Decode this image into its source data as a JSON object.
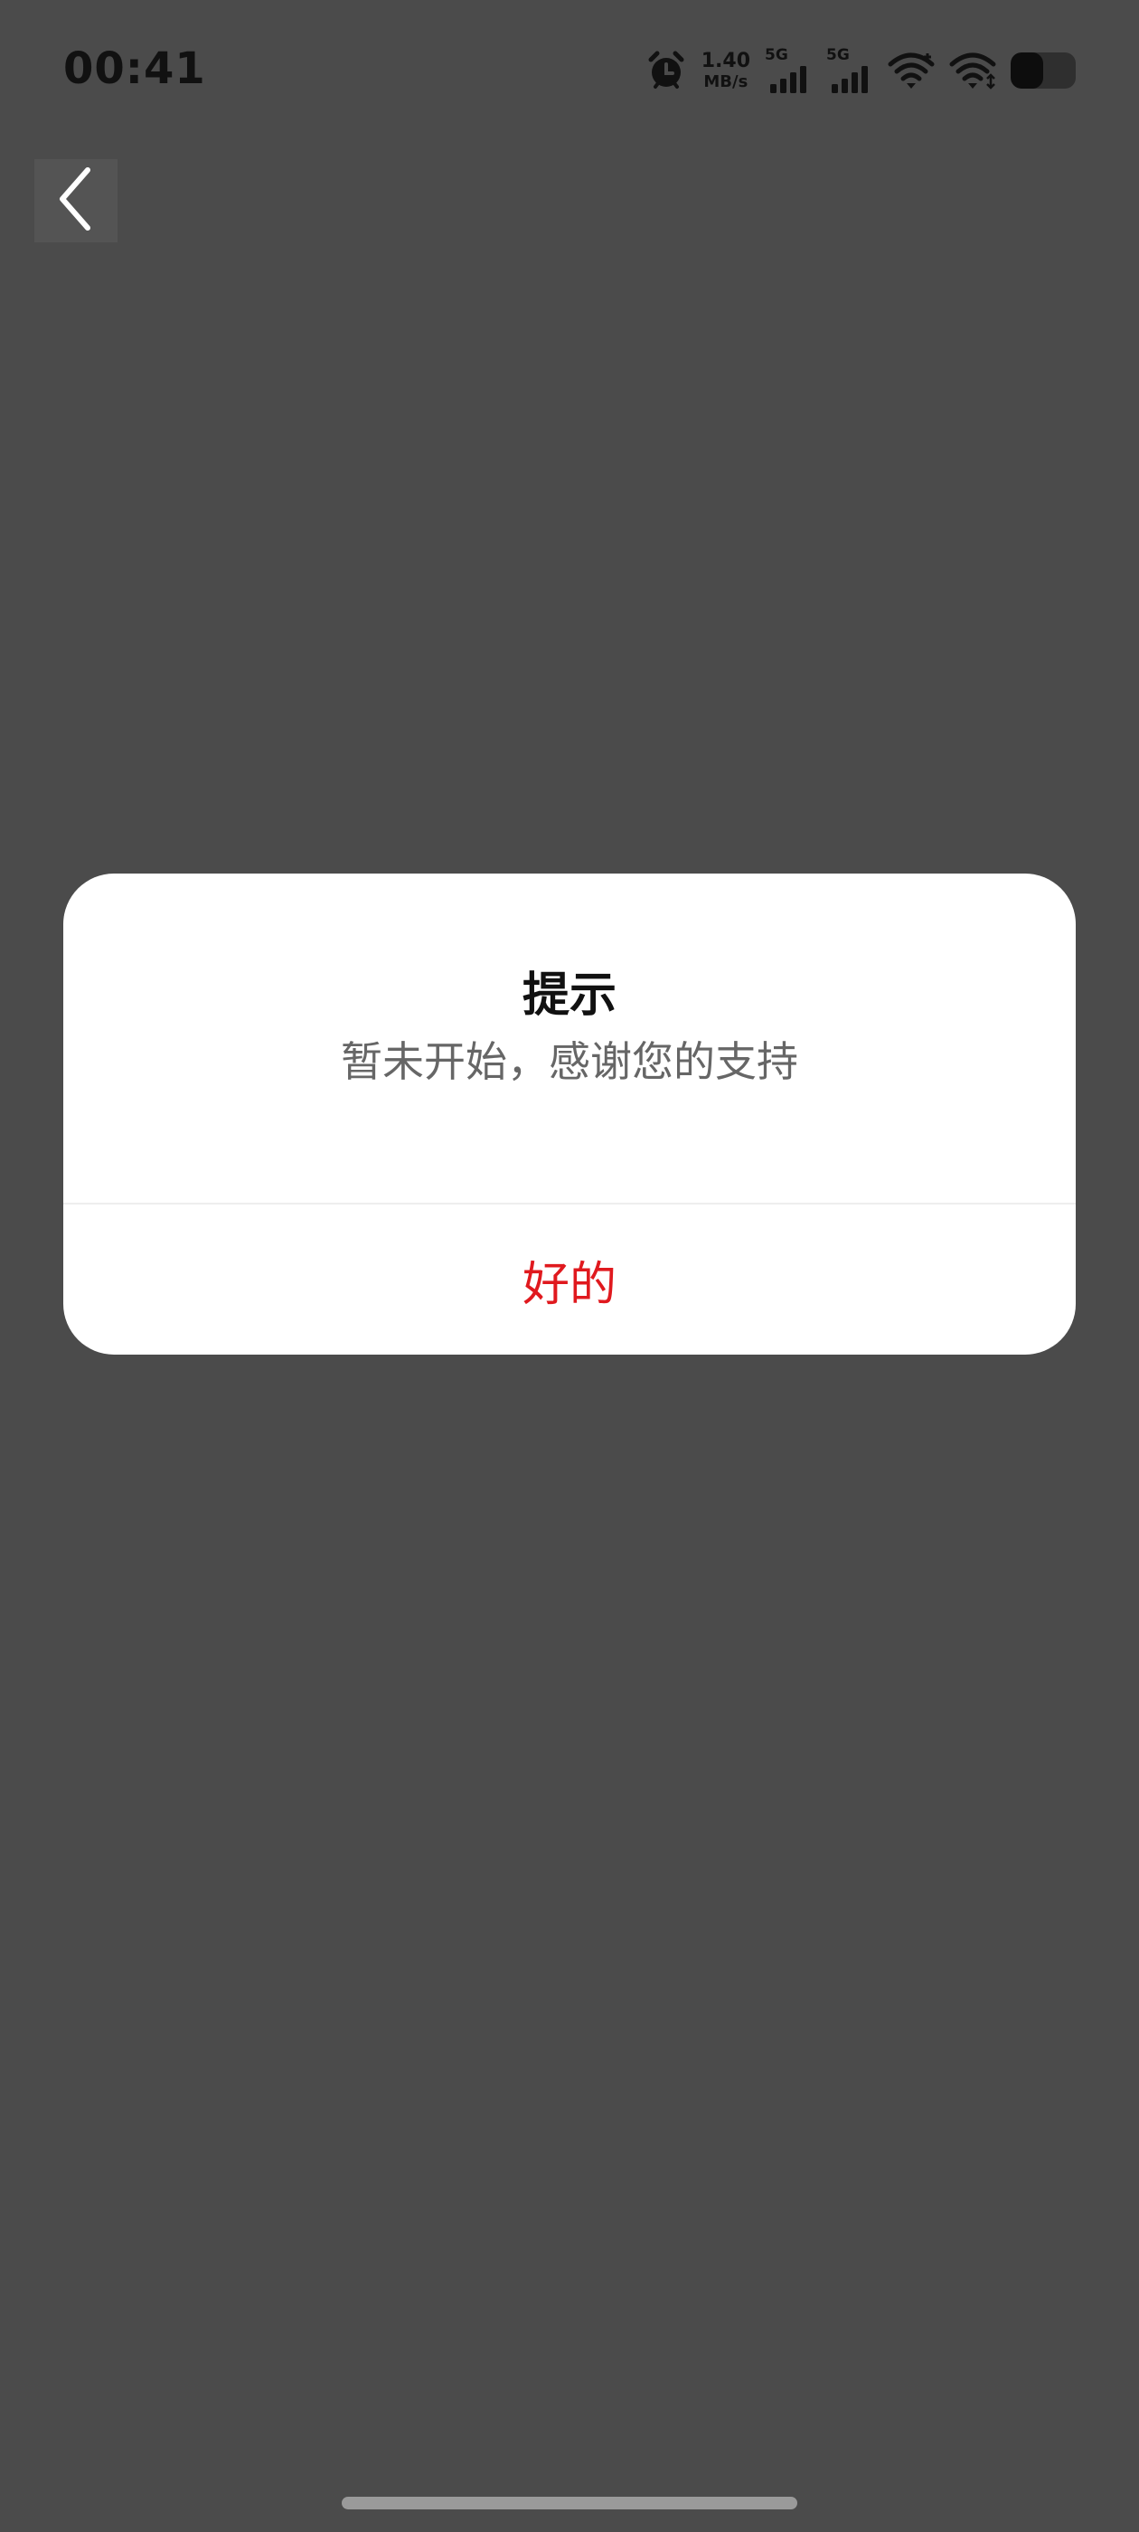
{
  "status_bar": {
    "time": "00:41",
    "net_speed_value": "1.40",
    "net_speed_unit": "MB/s",
    "sim1_tech": "5G",
    "sim2_tech": "5G",
    "battery_level": 0.5,
    "icons": [
      "alarm-icon",
      "signal-icon",
      "signal-icon",
      "wifi-icon",
      "wifi-icon",
      "battery-icon"
    ]
  },
  "nav": {
    "back_icon": "chevron-left-icon"
  },
  "dialog": {
    "title": "提示",
    "message": "暂未开始，感谢您的支持",
    "confirm_label": "好的"
  },
  "colors": {
    "overlay": "#4b4b4b",
    "dialog_bg": "#ffffff",
    "accent": "#e0191e",
    "message_text": "#666666"
  }
}
